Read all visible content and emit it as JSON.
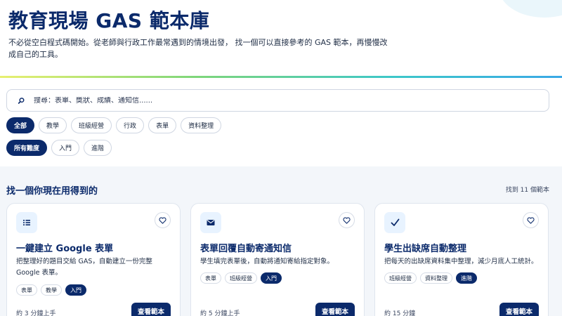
{
  "header": {
    "title": "教育現場 GAS 範本庫",
    "intro": "不必從空白程式碼開始。從老師與行政工作最常遇到的情境出發， 找一個可以直接參考的 GAS 範本，再慢慢改成自己的工具。"
  },
  "search": {
    "icon": "search-icon",
    "placeholder": "搜尋：表單、獎狀、成績、通知信......",
    "value": ""
  },
  "category_filters": [
    "全部",
    "教學",
    "班級經營",
    "行政",
    "表單",
    "資料整理"
  ],
  "active_category": "全部",
  "level_filters": [
    "所有難度",
    "入門",
    "進階"
  ],
  "active_level": "所有難度",
  "results": {
    "heading": "找一個你現在用得到的",
    "count": "找到 11 個範本"
  },
  "cards": [
    {
      "icon": "list-icon",
      "title": "一鍵建立 Google 表單",
      "description": "把整理好的題目交給 GAS，自動建立一份完整 Google 表單。",
      "tags": [
        "表單",
        "教學"
      ],
      "level": "入門",
      "time": "約 3 分鐘上手",
      "button": "查看範本"
    },
    {
      "icon": "envelope-icon",
      "title": "表單回覆自動寄通知信",
      "description": "學生填完表單後，自動將通知寄給指定對象。",
      "tags": [
        "表單",
        "班級經營"
      ],
      "level": "入門",
      "time": "約 5 分鐘上手",
      "button": "查看範本"
    },
    {
      "icon": "check-icon",
      "title": "學生出缺席自動整理",
      "description": "把每天的出缺席資料集中整理，減少月底人工統計。",
      "tags": [
        "班級經營",
        "資料整理"
      ],
      "level": "進階",
      "time": "約 15 分鐘",
      "button": "查看範本"
    }
  ],
  "colors": {
    "primary": "#0b2a6b",
    "accent_gradient": [
      "#e8f070",
      "#7ed67a",
      "#3cc7c9",
      "#39a8e6"
    ],
    "main_bg": "#f3f6fa"
  }
}
